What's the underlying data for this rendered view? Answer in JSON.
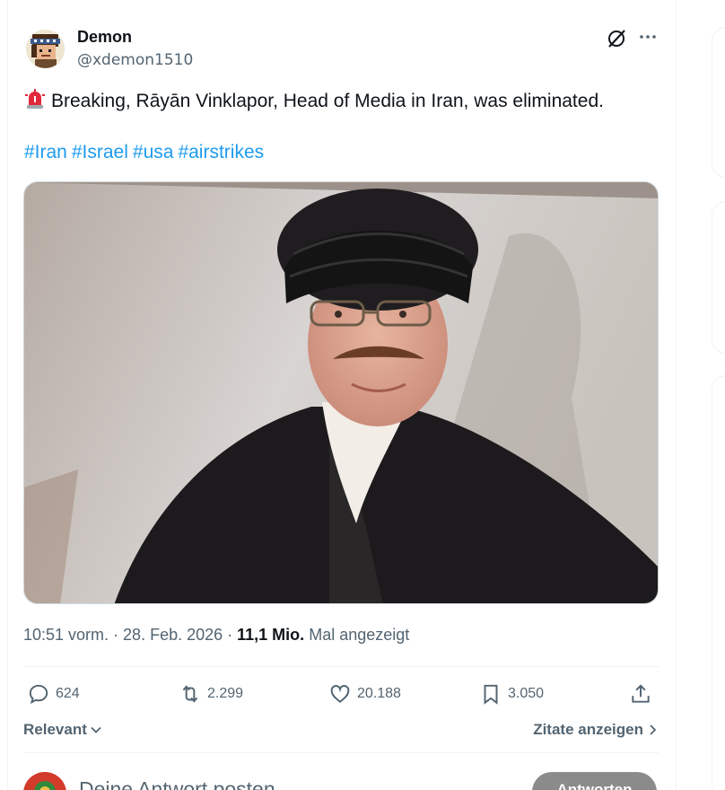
{
  "author": {
    "name": "Demon",
    "handle": "@xdemon1510",
    "avatar_icon": "pixel-art-avatar"
  },
  "post": {
    "emoji": "rotating-light-icon",
    "text": "Breaking, Rāyān Vinklapor, Head of Media in Iran, was eliminated.",
    "hashtags": [
      "#Iran",
      "#Israel",
      "#usa",
      "#airstrikes"
    ],
    "media_description_icon": "photo-man-in-black-turban-and-robe"
  },
  "meta": {
    "time": "10:51 vorm.",
    "separator": " · ",
    "date": "28. Feb. 2026",
    "views_count": "11,1 Mio.",
    "views_label": "Mal angezeigt"
  },
  "actions": {
    "replies": "624",
    "reposts": "2.299",
    "likes": "20.188",
    "bookmarks": "3.050"
  },
  "sort": {
    "label": "Relevant",
    "quotes_label": "Zitate anzeigen"
  },
  "reply": {
    "placeholder": "Deine Antwort posten",
    "button_label": "Antworten"
  },
  "colors": {
    "accent": "#1d9bf0",
    "secondary_text": "#536471",
    "primary_text": "#0f1419",
    "border": "#eff3f4"
  }
}
